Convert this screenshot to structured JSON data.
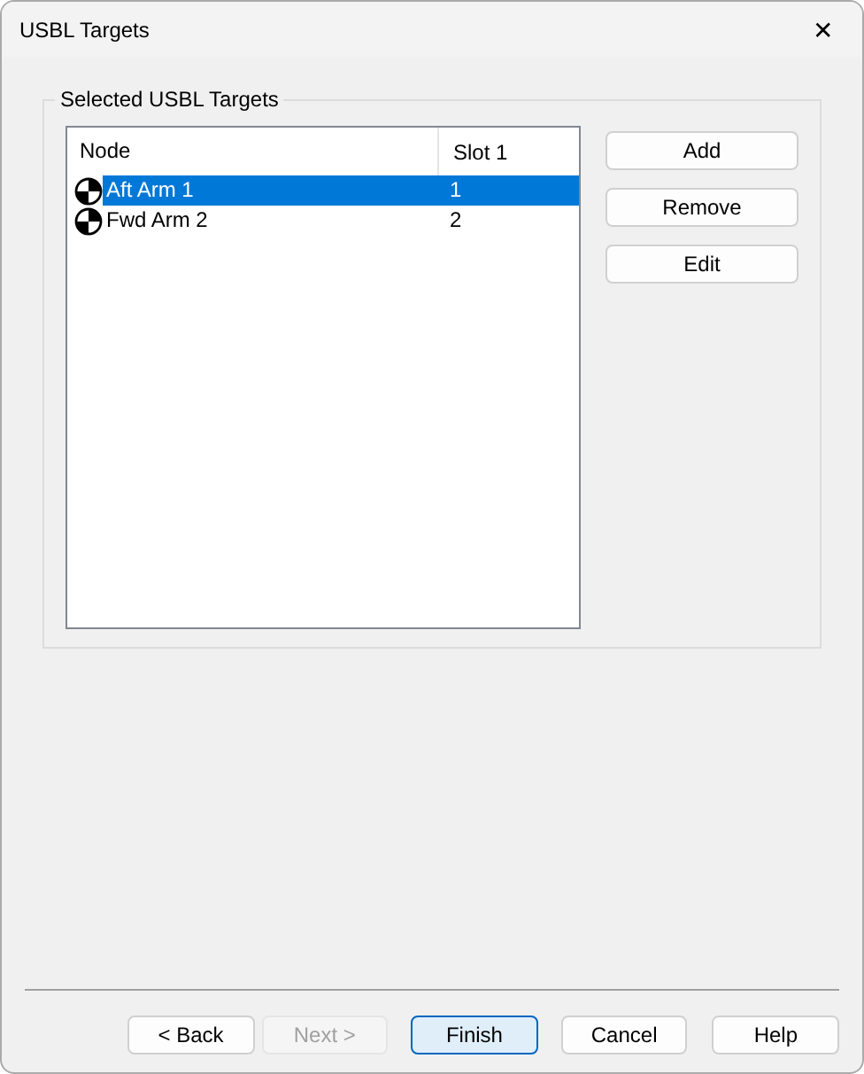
{
  "window": {
    "title": "USBL Targets",
    "close": "✕"
  },
  "group": {
    "title": "Selected USBL Targets"
  },
  "table": {
    "columns": [
      "Node",
      "Slot 1"
    ],
    "rows": [
      {
        "node": "Aft Arm 1",
        "slot": "1",
        "selected": true
      },
      {
        "node": "Fwd Arm 2",
        "slot": "2",
        "selected": false
      }
    ]
  },
  "side_buttons": [
    {
      "label": "Add"
    },
    {
      "label": "Remove"
    },
    {
      "label": "Edit"
    }
  ],
  "footer_buttons": [
    {
      "label": "< Back",
      "disabled": false,
      "default": false
    },
    {
      "label": "Next >",
      "disabled": true,
      "default": false
    },
    {
      "label": "Finish",
      "disabled": false,
      "default": true
    },
    {
      "label": "Cancel",
      "disabled": false,
      "default": false
    },
    {
      "label": "Help",
      "disabled": false,
      "default": false
    }
  ]
}
